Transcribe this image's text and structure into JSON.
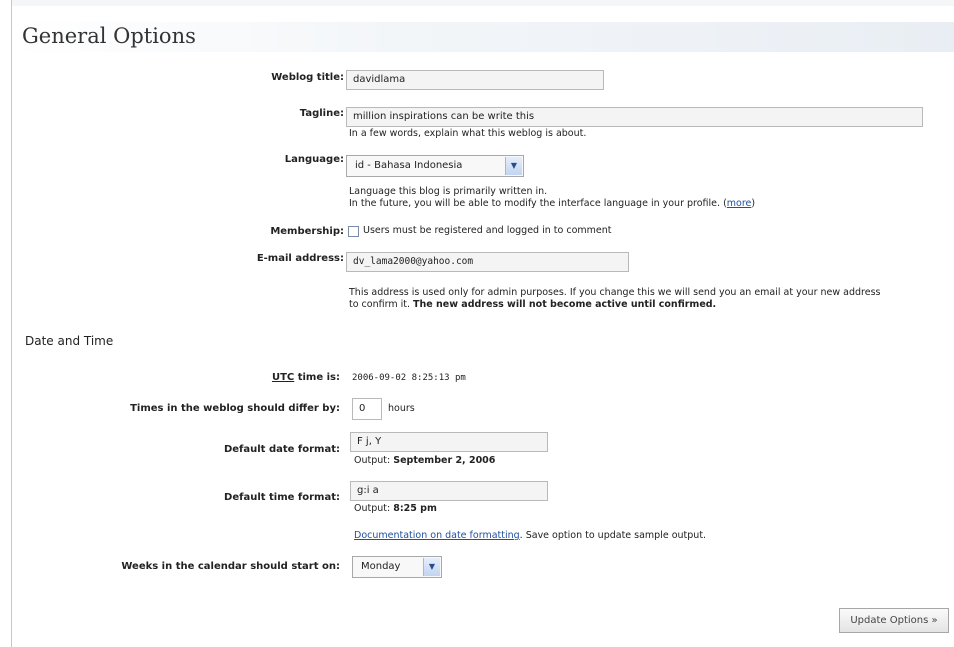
{
  "page": {
    "title": "General Options"
  },
  "general": {
    "weblog_title": {
      "label": "Weblog title:",
      "value": "davidlama"
    },
    "tagline": {
      "label": "Tagline:",
      "value": "million inspirations can be write this",
      "hint": "In a few words, explain what this weblog is about."
    },
    "language": {
      "label": "Language:",
      "selected": "id - Bahasa Indonesia",
      "hint_line1": "Language this blog is primarily written in.",
      "hint_line2": "In the future, you will be able to modify the interface language in your profile.",
      "more_open": "(",
      "more_link": "more",
      "more_close": ")"
    },
    "membership": {
      "label": "Membership:",
      "checkbox_label": "Users must be registered and logged in to comment",
      "checked": false
    },
    "email": {
      "label": "E-mail address:",
      "value": "dv_lama2000@yahoo.com",
      "hint_line1": "This address is used only for admin purposes. If you change this we will send you an email at your new address",
      "hint_line2_prefix": "to confirm it. ",
      "hint_line2_bold": "The new address will not become active until confirmed."
    }
  },
  "date_time": {
    "section_title": "Date and Time",
    "utc": {
      "abbr": "UTC",
      "label_rest": " time is:",
      "value": "2006-09-02 8:25:13 pm"
    },
    "offset": {
      "label": "Times in the weblog should differ by:",
      "value": "0",
      "unit": "hours"
    },
    "date_format": {
      "label": "Default date format:",
      "value": "F j, Y",
      "output_prefix": "Output: ",
      "output_value": "September 2, 2006"
    },
    "time_format": {
      "label": "Default time format:",
      "value": "g:i a",
      "output_prefix": "Output: ",
      "output_value": "8:25 pm"
    },
    "doc": {
      "link": "Documentation on date formatting",
      "rest": ". Save option to update sample output."
    },
    "week_start": {
      "label": "Weeks in the calendar should start on:",
      "selected": "Monday"
    }
  },
  "actions": {
    "update_label": "Update Options »"
  },
  "icons": {
    "dropdown": "chevron-down-icon",
    "checkbox": "checkbox-icon"
  },
  "colors": {
    "link": "#1f4fa0",
    "input_bg": "#f4f4f4",
    "select_arrow": "#2a4c8c"
  }
}
